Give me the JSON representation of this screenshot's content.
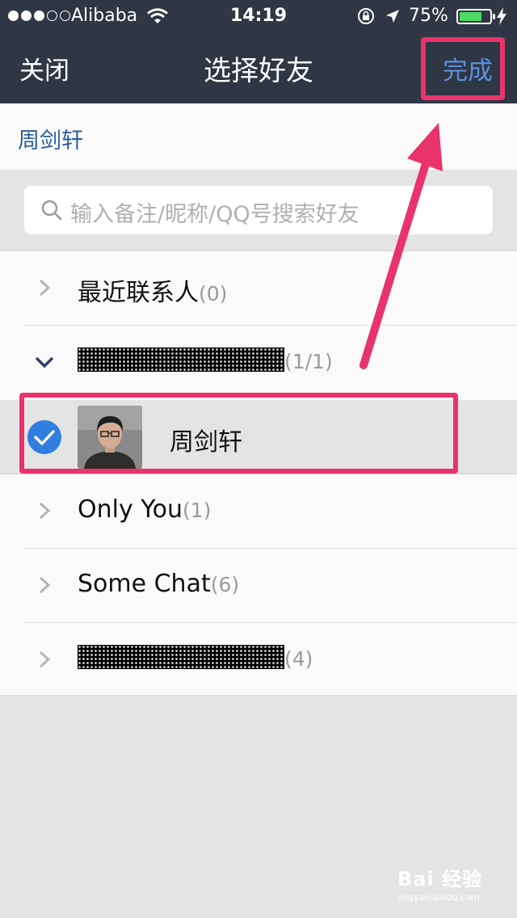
{
  "status_bar": {
    "carrier": "Alibaba",
    "time": "14:19",
    "battery_percent": "75%",
    "battery_level": 0.75,
    "signal_bars": 3,
    "signal_total": 5,
    "icons": [
      "wifi-icon",
      "rotation-lock-icon",
      "location-arrow-icon",
      "battery-icon",
      "charging-bolt-icon"
    ]
  },
  "nav": {
    "close_label": "关闭",
    "title": "选择好友",
    "done_label": "完成"
  },
  "selected": {
    "name": "周剑轩"
  },
  "search": {
    "placeholder": "输入备注/昵称/QQ号搜索好友"
  },
  "groups": [
    {
      "name": "最近联系人",
      "count": "(0)",
      "expanded": false,
      "redacted": false
    },
    {
      "name": "",
      "count": "(1/1)",
      "expanded": true,
      "redacted": true
    },
    {
      "name": "Only You",
      "count": "(1)",
      "expanded": false,
      "redacted": false
    },
    {
      "name": "Some Chat",
      "count": "(6)",
      "expanded": false,
      "redacted": false
    },
    {
      "name": "",
      "count": "(4)",
      "expanded": false,
      "redacted": true
    }
  ],
  "friend": {
    "name": "周剑轩",
    "checked": true
  },
  "watermark": {
    "main": "Bai 经验",
    "sub": "jingyan.baidu.com"
  },
  "colors": {
    "nav_bg": "#2f3644",
    "accent_blue": "#5b8fe0",
    "check_blue": "#2f7ee0",
    "annotation_pink": "#e8336b",
    "battery_green": "#4cd964"
  }
}
